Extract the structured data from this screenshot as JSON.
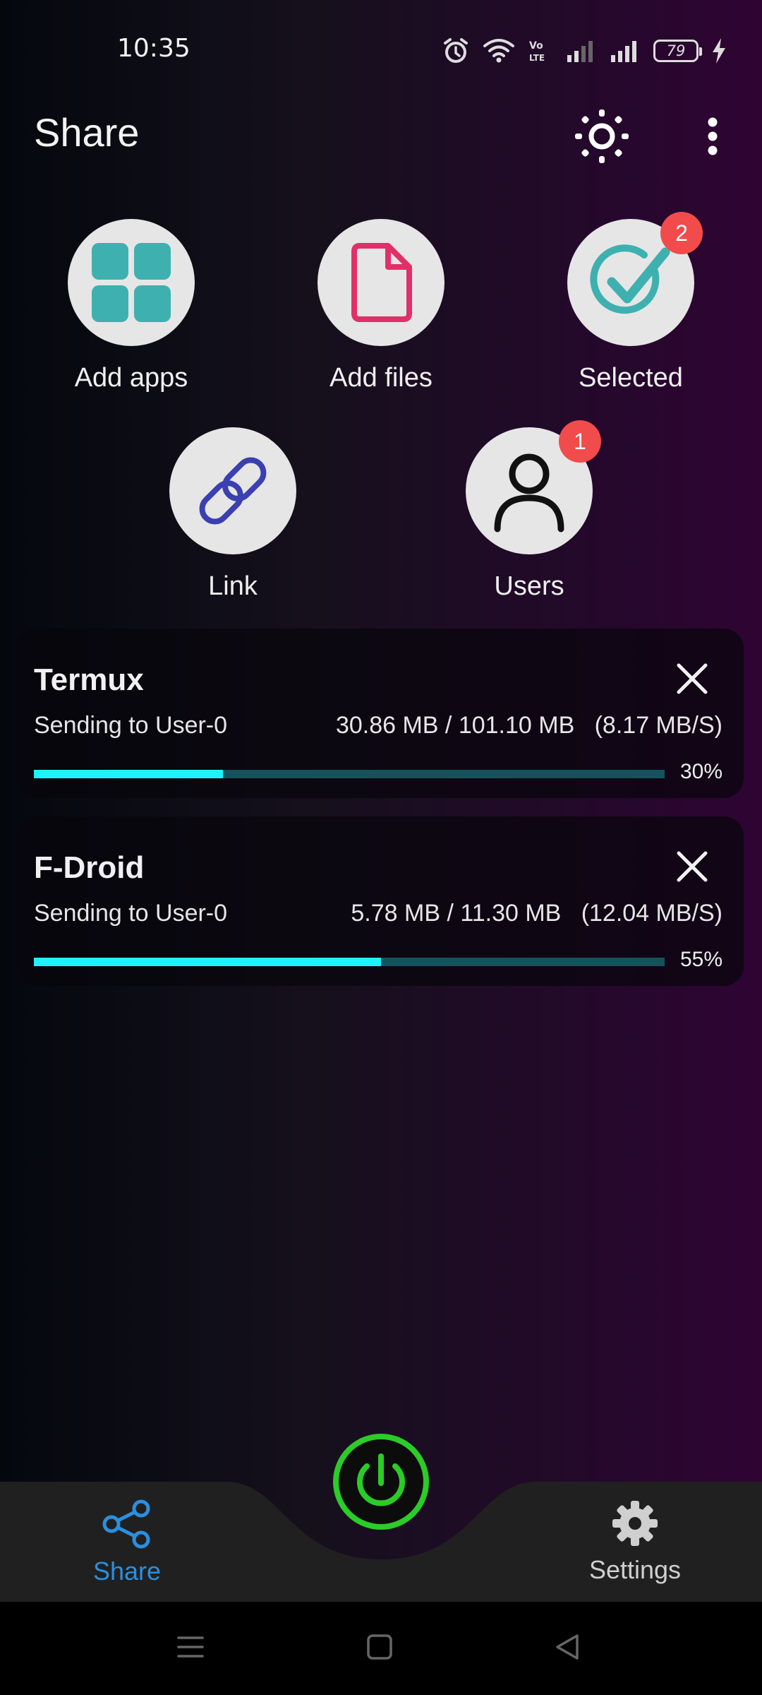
{
  "status_bar": {
    "time": "10:35",
    "battery": "79"
  },
  "header": {
    "title": "Share"
  },
  "actions": [
    {
      "label": "Add apps",
      "icon": "grid-icon"
    },
    {
      "label": "Add files",
      "icon": "file-icon"
    },
    {
      "label": "Selected",
      "icon": "check-icon",
      "badge": "2"
    },
    {
      "label": "Link",
      "icon": "link-icon"
    },
    {
      "label": "Users",
      "icon": "user-icon",
      "badge": "1"
    }
  ],
  "transfers": [
    {
      "name": "Termux",
      "subtitle": "Sending to User-0",
      "size": "30.86 MB / 101.10 MB",
      "speed": "(8.17 MB/S)",
      "progress_pct": 30,
      "percent": "30%"
    },
    {
      "name": "F-Droid",
      "subtitle": "Sending to User-0",
      "size": "5.78 MB / 11.30 MB",
      "speed": "(12.04 MB/S)",
      "progress_pct": 55,
      "percent": "55%"
    }
  ],
  "bottom_nav": {
    "share_label": "Share",
    "settings_label": "Settings"
  },
  "colors": {
    "accent_teal": "#3fb0b0",
    "file_pink": "#e0306a",
    "link_blue": "#3a3fb2",
    "badge_red": "#f14b4b",
    "progress_fill": "#1ef2ff",
    "progress_track": "#15525c",
    "power_green": "#2bcc27",
    "nav_active": "#2b8fe0",
    "nav_inactive": "#cfcfcf"
  }
}
